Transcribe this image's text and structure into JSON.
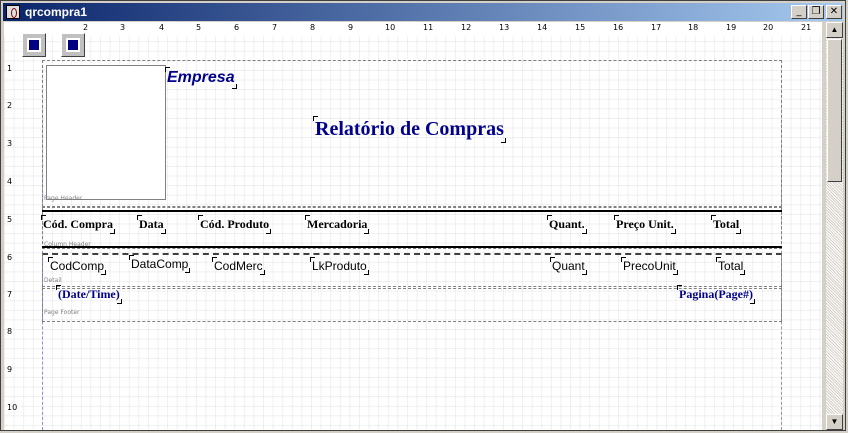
{
  "window": {
    "title": "qrcompra1",
    "minimize": "_",
    "restore": "❐",
    "close": "✕"
  },
  "ruler": {
    "top": [
      "2",
      "3",
      "4",
      "5",
      "6",
      "7",
      "8",
      "9",
      "10",
      "11",
      "12",
      "13",
      "14",
      "15",
      "16",
      "17",
      "18",
      "19",
      "20",
      "21"
    ],
    "left": [
      "1",
      "2",
      "3",
      "4",
      "5",
      "6",
      "7",
      "8",
      "9",
      "10"
    ]
  },
  "toolbar": {
    "expand_icon": "band-setup-icon",
    "collapse_icon": "report-settings-icon"
  },
  "bands": {
    "page_header": "Page Header",
    "column_header": "Column Header",
    "detail": "Detail",
    "page_footer": "Page Footer"
  },
  "page_header": {
    "company": "Empresa",
    "title": "Relatório de Compras"
  },
  "column_header": [
    "Cód. Compra",
    "Data",
    "Cód. Produto",
    "Mercadoria",
    "Quant.",
    "Preço Unit.",
    "Total"
  ],
  "detail": [
    "CodComp",
    "DataComp",
    "CodMerc",
    "LkProduto",
    "Quant",
    "PrecoUnit",
    "Total"
  ],
  "page_footer": {
    "datetime": "(Date/Time)",
    "page": "Pagina(Page#)"
  },
  "scrollbar": {
    "up": "▲",
    "down": "▼"
  }
}
